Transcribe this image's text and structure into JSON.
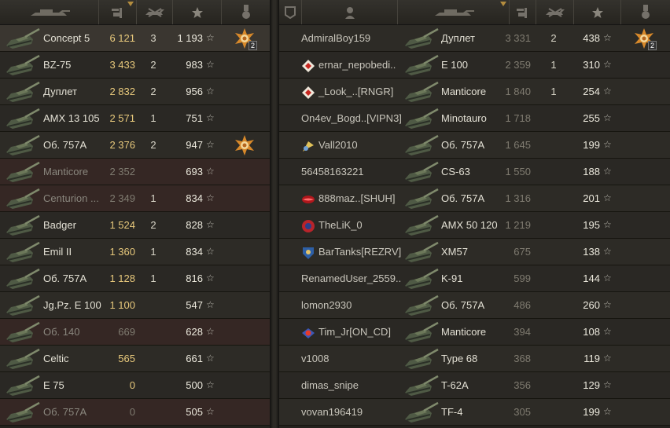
{
  "team1": {
    "header_icons": [
      "tank-icon",
      "sort-arrow-icon",
      "experience-icon",
      "frags-icon",
      "star-icon",
      "medal-icon"
    ],
    "rows": [
      {
        "tank": "Concept 5",
        "exp": "6 121",
        "frags": "3",
        "score": "1 193",
        "medal": true,
        "medal_count": "2",
        "style": "me"
      },
      {
        "tank": "BZ-75",
        "exp": "3 433",
        "frags": "2",
        "score": "983",
        "medal": false,
        "style": "normal"
      },
      {
        "tank": "Дуплет",
        "exp": "2 832",
        "frags": "2",
        "score": "956",
        "medal": false,
        "style": "normal"
      },
      {
        "tank": "AMX 13 105",
        "exp": "2 571",
        "frags": "1",
        "score": "751",
        "medal": false,
        "style": "normal"
      },
      {
        "tank": "Об. 757А",
        "exp": "2 376",
        "frags": "2",
        "score": "947",
        "medal": true,
        "medal_count": "",
        "style": "normal"
      },
      {
        "tank": "Manticore",
        "exp": "2 352",
        "frags": "",
        "score": "693",
        "medal": false,
        "style": "dim"
      },
      {
        "tank": "Centurion ...",
        "exp": "2 349",
        "frags": "1",
        "score": "834",
        "medal": false,
        "style": "dim"
      },
      {
        "tank": "Badger",
        "exp": "1 524",
        "frags": "2",
        "score": "828",
        "medal": false,
        "style": "normal"
      },
      {
        "tank": "Emil II",
        "exp": "1 360",
        "frags": "1",
        "score": "834",
        "medal": false,
        "style": "normal"
      },
      {
        "tank": "Об. 757А",
        "exp": "1 128",
        "frags": "1",
        "score": "816",
        "medal": false,
        "style": "normal"
      },
      {
        "tank": "Jg.Pz. E 100",
        "exp": "1 100",
        "frags": "",
        "score": "547",
        "medal": false,
        "style": "normal"
      },
      {
        "tank": "Об. 140",
        "exp": "669",
        "frags": "",
        "score": "628",
        "medal": false,
        "style": "dim"
      },
      {
        "tank": "Celtic",
        "exp": "565",
        "frags": "",
        "score": "661",
        "medal": false,
        "style": "normal"
      },
      {
        "tank": "E 75",
        "exp": "0",
        "frags": "",
        "score": "500",
        "medal": false,
        "style": "normal"
      },
      {
        "tank": "Об. 757А",
        "exp": "0",
        "frags": "",
        "score": "505",
        "medal": false,
        "style": "dim"
      }
    ]
  },
  "team2": {
    "header_icons": [
      "platoon-icon",
      "player-icon",
      "tank-icon",
      "sort-arrow-icon",
      "experience-icon",
      "frags-icon",
      "star-icon",
      "medal-icon"
    ],
    "rows": [
      {
        "player": "AdmiralBoy159",
        "clan_icon": "",
        "tank": "Дуплет",
        "exp": "3 331",
        "frags": "2",
        "score": "438",
        "medal": true,
        "medal_count": "2"
      },
      {
        "player": "ernar_nepobedi..",
        "clan_icon": "diamond-icon",
        "tank": "E 100",
        "exp": "2 359",
        "frags": "1",
        "score": "310",
        "medal": false
      },
      {
        "player": "_Look_..[RNGR]",
        "clan_icon": "diamond-icon",
        "tank": "Manticore",
        "exp": "1 840",
        "frags": "1",
        "score": "254",
        "medal": false
      },
      {
        "player": "On4ev_Bogd..[VIPN3]",
        "clan_icon": "",
        "tank": "Minotauro",
        "exp": "1 718",
        "frags": "",
        "score": "255",
        "medal": false
      },
      {
        "player": "Vall2010",
        "clan_icon": "flag-icon",
        "tank": "Об. 757А",
        "exp": "1 645",
        "frags": "",
        "score": "199",
        "medal": false
      },
      {
        "player": "56458163221",
        "clan_icon": "",
        "tank": "CS-63",
        "exp": "1 550",
        "frags": "",
        "score": "188",
        "medal": false
      },
      {
        "player": "888maz..[SHUH]",
        "clan_icon": "lips-icon",
        "tank": "Об. 757А",
        "exp": "1 316",
        "frags": "",
        "score": "201",
        "medal": false
      },
      {
        "player": "TheLiK_0",
        "clan_icon": "circle-emblem-icon",
        "tank": "AMX 50 120",
        "exp": "1 219",
        "frags": "",
        "score": "195",
        "medal": false
      },
      {
        "player": "BarTanks[REZRV]",
        "clan_icon": "shield-emblem-icon",
        "tank": "XM57",
        "exp": "675",
        "frags": "",
        "score": "138",
        "medal": false
      },
      {
        "player": "RenamedUser_2559..",
        "clan_icon": "",
        "tank": "K-91",
        "exp": "599",
        "frags": "",
        "score": "144",
        "medal": false
      },
      {
        "player": "lomon2930",
        "clan_icon": "",
        "tank": "Об. 757А",
        "exp": "486",
        "frags": "",
        "score": "260",
        "medal": false
      },
      {
        "player": "Tim_Jr[ON_CD]",
        "clan_icon": "badge-icon",
        "tank": "Manticore",
        "exp": "394",
        "frags": "",
        "score": "108",
        "medal": false
      },
      {
        "player": "v1008",
        "clan_icon": "",
        "tank": "Type 68",
        "exp": "368",
        "frags": "",
        "score": "119",
        "medal": false
      },
      {
        "player": "dimas_snipe",
        "clan_icon": "",
        "tank": "T-62A",
        "exp": "356",
        "frags": "",
        "score": "129",
        "medal": false
      },
      {
        "player": "vovan196419",
        "clan_icon": "",
        "tank": "TF-4",
        "exp": "305",
        "frags": "",
        "score": "199",
        "medal": false
      }
    ]
  },
  "colors": {
    "exp_gold": "#e8c97c",
    "text": "#e3e0d4",
    "dim_row": "#352724",
    "medal": "#d8892a"
  }
}
